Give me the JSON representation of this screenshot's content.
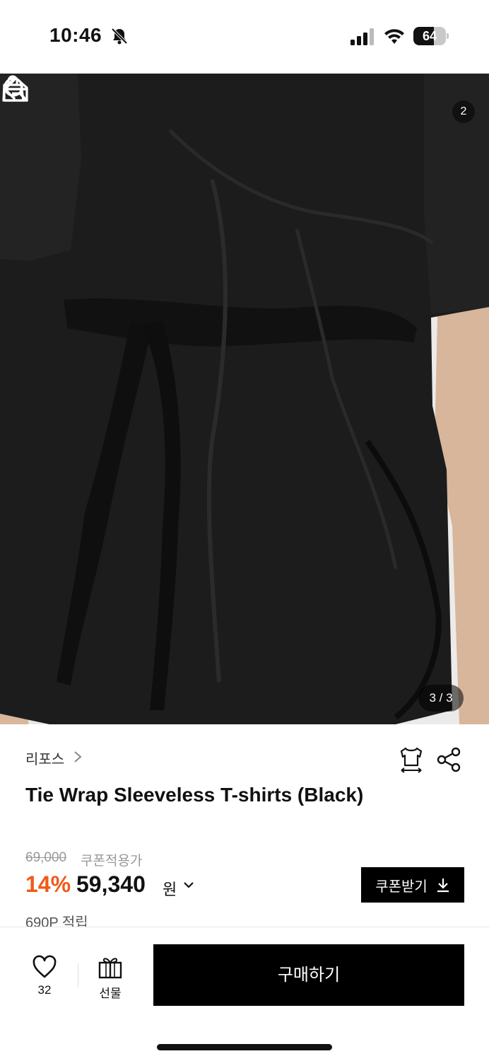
{
  "status_bar": {
    "time": "10:46",
    "battery": "64",
    "battery_level": 0.64
  },
  "nav": {
    "cart_count": "2"
  },
  "gallery": {
    "counter": "3 / 3"
  },
  "product": {
    "brand": "리포스",
    "title": "Tie Wrap Sleeveless T-shirts (Black)",
    "original_price": "69,000",
    "coupon_note": "쿠폰적용가",
    "discount": "14%",
    "price": "59,340",
    "currency": "원",
    "points": "690P 적립"
  },
  "coupon_button": {
    "label": "쿠폰받기"
  },
  "bottom_bar": {
    "likes": "32",
    "gift_label": "선물",
    "buy_label": "구매하기"
  },
  "colors": {
    "discount": "#f05a1a",
    "primary": "#000000"
  }
}
